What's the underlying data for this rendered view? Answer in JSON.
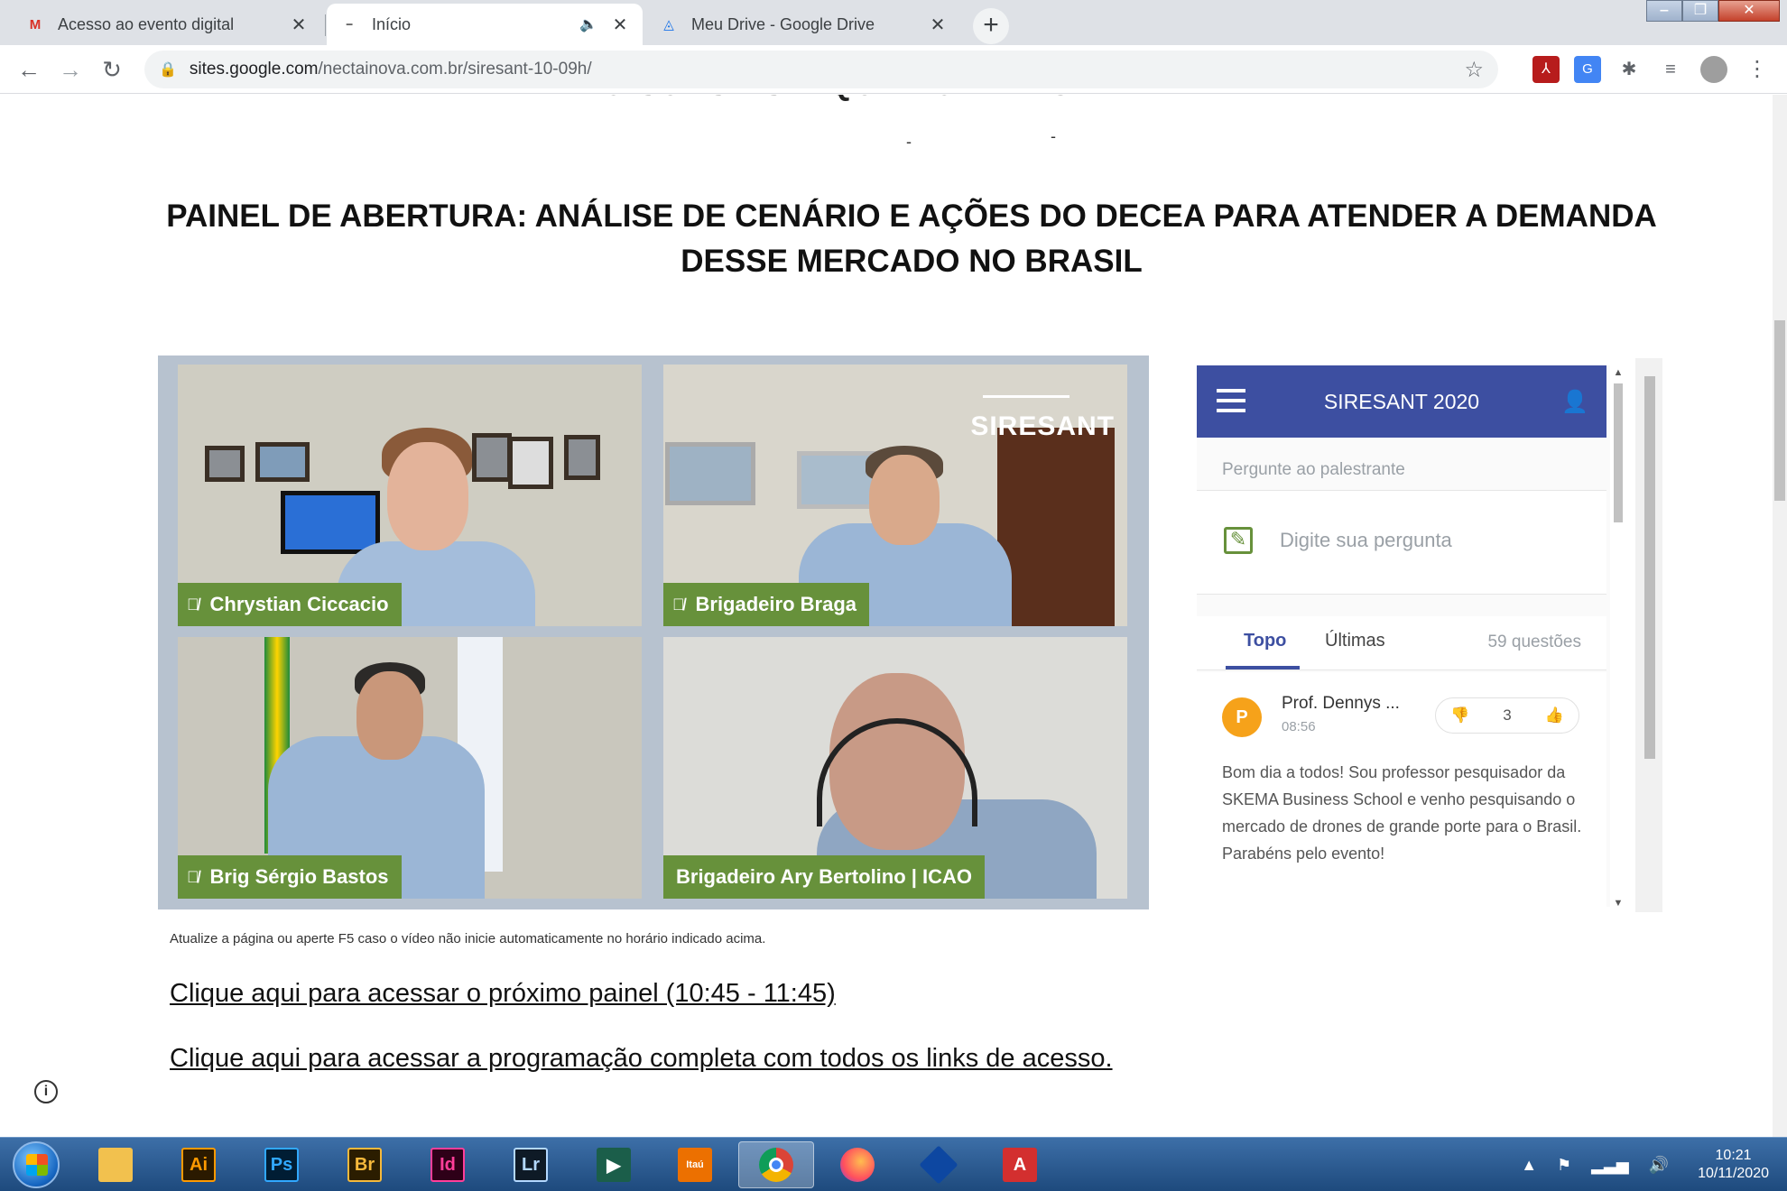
{
  "browser": {
    "tabs": [
      {
        "label": "Acesso ao evento digital",
        "favicon": "gmail-icon"
      },
      {
        "label": "Início",
        "favicon": "sites-icon"
      },
      {
        "label": "Meu Drive - Google Drive",
        "favicon": "drive-icon"
      }
    ],
    "url_host": "sites.google.com",
    "url_path": "/nectainova.com.br/siresant-10-09h/"
  },
  "page": {
    "clipped_heading": "DO SUAS AS E QUAL O PRINCIPAL BEN",
    "headline_line1": "PAINEL DE ABERTURA: ANÁLISE DE CENÁRIO E AÇÕES DO DECEA PARA ATENDER A DEMANDA",
    "headline_line2": "DESSE MERCADO NO BRASIL",
    "video": {
      "logo": "SIRESANT",
      "participants": [
        {
          "name": "Chrystian Ciccacio",
          "muted": true
        },
        {
          "name": "Brigadeiro Braga",
          "muted": true
        },
        {
          "name": "Brig Sérgio Bastos",
          "muted": true
        },
        {
          "name": "Brigadeiro Ary Bertolino | ICAO",
          "muted": false
        }
      ]
    },
    "caption": "Atualize a página ou aperte F5 caso o vídeo não inicie automaticamente no horário indicado acima.",
    "link_next": "Clique aqui para acessar o próximo painel (10:45 - 11:45)",
    "link_program": "Clique aqui para acessar a programação completa com todos os links de acesso."
  },
  "qa": {
    "title": "SIRESANT 2020",
    "ask_label": "Pergunte ao palestrante",
    "input_placeholder": "Digite sua pergunta",
    "tabs": [
      "Topo",
      "Últimas"
    ],
    "count": "59 questões",
    "question": {
      "avatar_letter": "P",
      "author": "Prof. Dennys ...",
      "time": "08:56",
      "votes": "3",
      "text": "Bom dia a todos! Sou professor pesquisador da SKEMA Business School e venho pesquisando o mercado de drones de grande porte para o Brasil. Parabéns pelo evento!"
    }
  },
  "taskbar": {
    "apps": [
      "Ai",
      "Ps",
      "Br",
      "Id",
      "Lr",
      "Itaú"
    ],
    "time": "10:21",
    "date": "10/11/2020"
  },
  "colors": {
    "qa_header": "#3d4fa1",
    "nameplate": "#67913b",
    "avatar": "#f6a21a"
  }
}
